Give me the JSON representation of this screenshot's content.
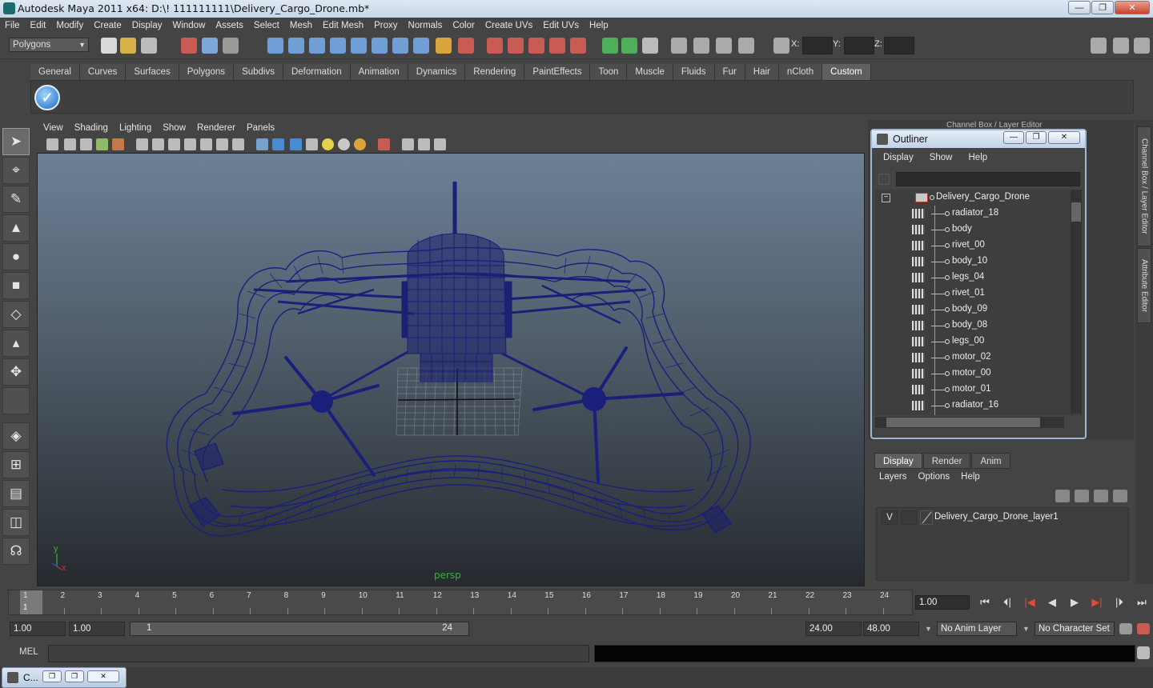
{
  "window": {
    "title": "Autodesk Maya 2011 x64: D:\\! 111111111\\Delivery_Cargo_Drone.mb*",
    "buttons": [
      "—",
      "❐",
      "✕"
    ]
  },
  "menubar": [
    "File",
    "Edit",
    "Modify",
    "Create",
    "Display",
    "Window",
    "Assets",
    "Select",
    "Mesh",
    "Edit Mesh",
    "Proxy",
    "Normals",
    "Color",
    "Create UVs",
    "Edit UVs",
    "Help"
  ],
  "statusline": {
    "mode": "Polygons",
    "x_label": "X:",
    "y_label": "Y:",
    "z_label": "Z:"
  },
  "shelf": {
    "tabs": [
      "General",
      "Curves",
      "Surfaces",
      "Polygons",
      "Subdivs",
      "Deformation",
      "Animation",
      "Dynamics",
      "Rendering",
      "PaintEffects",
      "Toon",
      "Muscle",
      "Fluids",
      "Fur",
      "Hair",
      "nCloth",
      "Custom"
    ],
    "active_tab": "Custom"
  },
  "viewport": {
    "menu": [
      "View",
      "Shading",
      "Lighting",
      "Show",
      "Renderer",
      "Panels"
    ],
    "camera": "persp",
    "axis_x": "x",
    "axis_y": "y",
    "wire_color": "#1a1f7a"
  },
  "right_strip": {
    "channel_title": "Channel Box / Layer Editor",
    "tab1": "Channel Box / Layer Editor",
    "tab2": "Attribute Editor"
  },
  "outliner": {
    "title": "Outliner",
    "menu": [
      "Display",
      "Show",
      "Help"
    ],
    "root": "Delivery_Cargo_Drone",
    "expander": "−",
    "items": [
      "radiator_18",
      "body",
      "rivet_00",
      "body_10",
      "legs_04",
      "rivet_01",
      "body_09",
      "body_08",
      "legs_00",
      "motor_02",
      "motor_00",
      "motor_01",
      "radiator_16"
    ]
  },
  "layers": {
    "tabs": [
      "Display",
      "Render",
      "Anim"
    ],
    "active_tab": "Display",
    "menu": [
      "Layers",
      "Options",
      "Help"
    ],
    "row": {
      "visible": "V",
      "name": "Delivery_Cargo_Drone_layer1"
    }
  },
  "timeline": {
    "ticks": [
      "1",
      "2",
      "3",
      "4",
      "5",
      "6",
      "7",
      "8",
      "9",
      "10",
      "11",
      "12",
      "13",
      "14",
      "15",
      "16",
      "17",
      "18",
      "19",
      "20",
      "21",
      "22",
      "23",
      "24"
    ],
    "current_label": "1",
    "current_frame": "1.00",
    "play_buttons": [
      "⏮",
      "⏴|",
      "|◀",
      "◀",
      "▶",
      "▶|",
      "|⏵",
      "⏭"
    ]
  },
  "range": {
    "start": "1.00",
    "anim_start": "1.00",
    "slider_start": "1",
    "slider_end": "24",
    "end": "24.00",
    "anim_end": "48.00",
    "anim_layer": "No Anim Layer",
    "character_set": "No Character Set"
  },
  "command": {
    "label": "MEL"
  },
  "minimized": {
    "title": "C..."
  }
}
